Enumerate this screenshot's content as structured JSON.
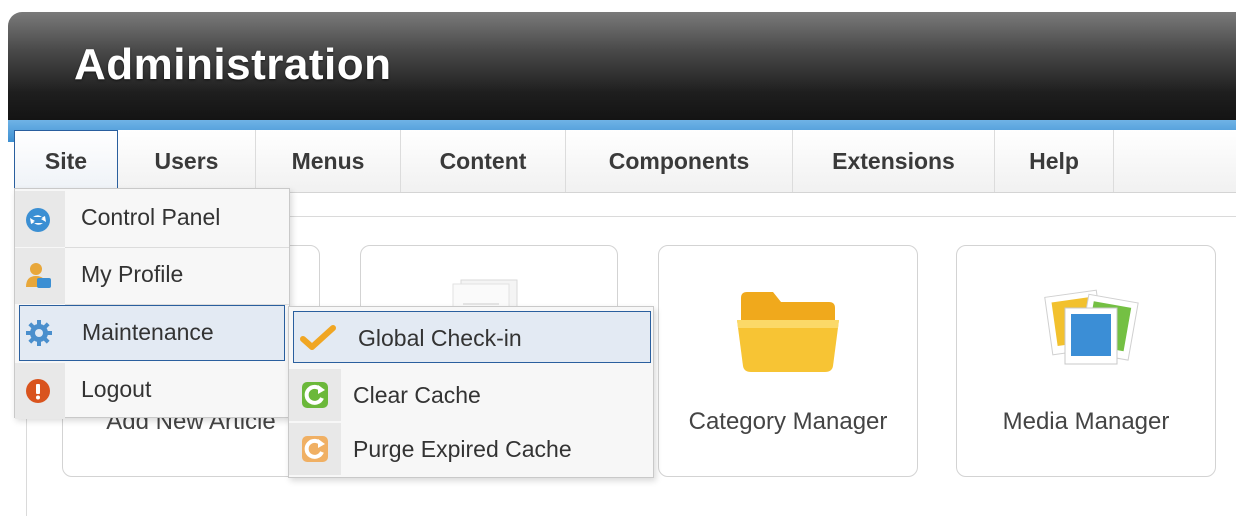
{
  "header": {
    "title": "Administration"
  },
  "menubar": {
    "items": [
      {
        "label": "Site"
      },
      {
        "label": "Users"
      },
      {
        "label": "Menus"
      },
      {
        "label": "Content"
      },
      {
        "label": "Components"
      },
      {
        "label": "Extensions"
      },
      {
        "label": "Help"
      }
    ],
    "active": "Site"
  },
  "site_menu": {
    "items": [
      {
        "label": "Control Panel",
        "icon": "control-panel-icon"
      },
      {
        "label": "My Profile",
        "icon": "user-profile-icon"
      },
      {
        "label": "Maintenance",
        "icon": "gear-icon"
      },
      {
        "label": "Logout",
        "icon": "logout-icon"
      }
    ],
    "highlighted": "Maintenance"
  },
  "maintenance_submenu": {
    "items": [
      {
        "label": "Global Check-in",
        "icon": "checkmark-icon"
      },
      {
        "label": "Clear Cache",
        "icon": "refresh-green-icon"
      },
      {
        "label": "Purge Expired Cache",
        "icon": "refresh-orange-icon"
      }
    ],
    "highlighted": "Global Check-in"
  },
  "cards": [
    {
      "label": "Add New Article",
      "icon": "article-icon"
    },
    {
      "label": "",
      "icon": "article-manager-icon"
    },
    {
      "label": "Category Manager",
      "icon": "folder-icon"
    },
    {
      "label": "Media Manager",
      "icon": "media-icon"
    }
  ],
  "colors": {
    "accent_blue": "#3d8fd1",
    "highlight_border": "#2a5f9e",
    "header_dark": "#1e1e1e"
  }
}
